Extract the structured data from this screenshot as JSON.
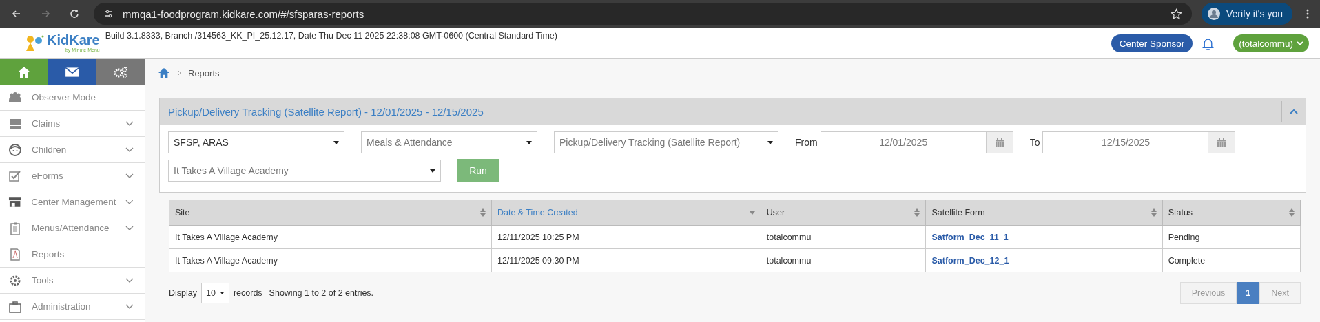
{
  "browser": {
    "url": "mmqa1-foodprogram.kidkare.com/#/sfsparas-reports",
    "profile_button": "Verify it's you"
  },
  "header": {
    "logo_text": "KidKare",
    "logo_tagline": "by Minute Menu",
    "build_info": "Build 3.1.8333, Branch /314563_KK_PI_25.12.17, Date Thu Dec 11 2025 22:38:08 GMT-0600 (Central Standard Time)",
    "sponsor_button": "Center Sponsor",
    "user_menu": "(totalcommu)"
  },
  "sidebar": {
    "tabs": [
      {
        "color": "#5fa23d"
      },
      {
        "color": "#2a5ba8"
      },
      {
        "color": "#777777"
      }
    ],
    "items": [
      {
        "label": "Observer Mode",
        "expandable": false
      },
      {
        "label": "Claims",
        "expandable": true
      },
      {
        "label": "Children",
        "expandable": true
      },
      {
        "label": "eForms",
        "expandable": true
      },
      {
        "label": "Center Management",
        "expandable": true
      },
      {
        "label": "Menus/Attendance",
        "expandable": true
      },
      {
        "label": "Reports",
        "expandable": false
      },
      {
        "label": "Tools",
        "expandable": true
      },
      {
        "label": "Administration",
        "expandable": true
      }
    ]
  },
  "breadcrumb": "Reports",
  "panel": {
    "title": "Pickup/Delivery Tracking (Satellite Report) - 12/01/2025 - 12/15/2025",
    "expanded": true,
    "selects": [
      {
        "value": "SFSP, ARAS"
      },
      {
        "value": "Meals & Attendance"
      },
      {
        "value": "Pickup/Delivery Tracking (Satellite Report)"
      }
    ],
    "from_label": "From",
    "from_value": "12/01/2025",
    "to_label": "To",
    "to_value": "12/15/2025",
    "site_select": "It Takes A Village Academy",
    "run_button": "Run"
  },
  "table": {
    "columns": [
      {
        "label": "Site",
        "sorted": false
      },
      {
        "label": "Date & Time Created",
        "sorted": true
      },
      {
        "label": "User",
        "sorted": false
      },
      {
        "label": "Satellite Form",
        "sorted": false
      },
      {
        "label": "Status",
        "sorted": false
      }
    ],
    "rows": [
      [
        "It Takes A Village Academy",
        "12/11/2025 10:25 PM",
        "totalcommu",
        "Satform_Dec_11_1",
        "Pending"
      ],
      [
        "It Takes A Village Academy",
        "12/11/2025 09:30 PM",
        "totalcommu",
        "Satform_Dec_12_1",
        "Complete"
      ]
    ]
  },
  "footer": {
    "display_label": "Display",
    "page_size": "10",
    "records_label": "records",
    "summary": "Showing 1 to 2 of 2 entries.",
    "pagination": [
      {
        "label": "Previous",
        "kind": "nav",
        "selected": false
      },
      {
        "label": "1",
        "kind": "page",
        "selected": true
      },
      {
        "label": "Next",
        "kind": "nav",
        "selected": false
      }
    ]
  }
}
